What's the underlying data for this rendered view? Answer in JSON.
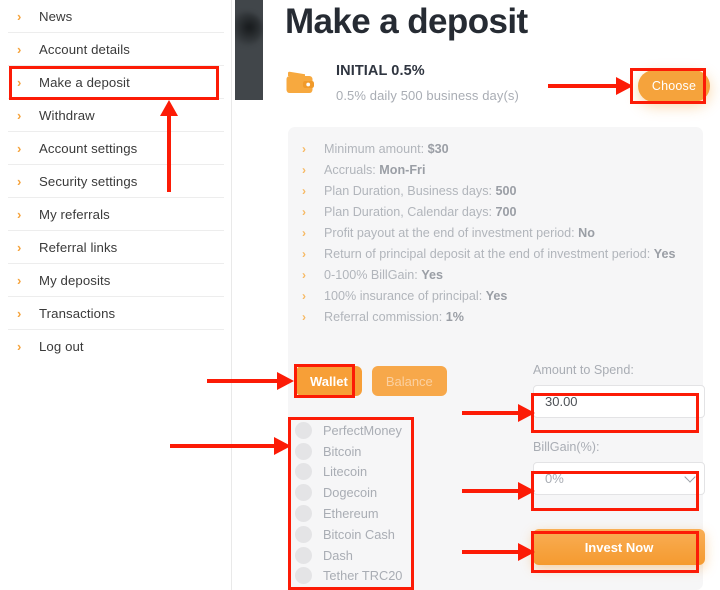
{
  "sidebar": {
    "items": [
      {
        "label": "News",
        "icon": "chevron-right-icon"
      },
      {
        "label": "Account details",
        "icon": "chevron-right-icon"
      },
      {
        "label": "Make a deposit",
        "icon": "chevron-right-icon"
      },
      {
        "label": "Withdraw",
        "icon": "chevron-right-icon"
      },
      {
        "label": "Account settings",
        "icon": "chevron-right-icon"
      },
      {
        "label": "Security settings",
        "icon": "chevron-right-icon"
      },
      {
        "label": "My referrals",
        "icon": "chevron-right-icon"
      },
      {
        "label": "Referral links",
        "icon": "chevron-right-icon"
      },
      {
        "label": "My deposits",
        "icon": "chevron-right-icon"
      },
      {
        "label": "Transactions",
        "icon": "chevron-right-icon"
      },
      {
        "label": "Log out",
        "icon": "chevron-right-icon"
      }
    ]
  },
  "main": {
    "page_title": "Make a deposit",
    "plan": {
      "icon": "wallet-icon",
      "name": "INITIAL 0.5%",
      "subtitle": "0.5% daily 500 business day(s)",
      "choose_label": "Choose"
    },
    "details": [
      {
        "label": "Minimum amount: ",
        "value": "$30"
      },
      {
        "label": "Accruals: ",
        "value": "Mon-Fri"
      },
      {
        "label": "Plan Duration, Business days: ",
        "value": "500"
      },
      {
        "label": "Plan Duration, Calendar days: ",
        "value": "700"
      },
      {
        "label": "Profit payout at the end of investment period: ",
        "value": "No"
      },
      {
        "label": "Return of principal deposit at the end of investment period: ",
        "value": "Yes"
      },
      {
        "label": "0-100% BillGain: ",
        "value": "Yes"
      },
      {
        "label": "100% insurance of principal: ",
        "value": "Yes"
      },
      {
        "label": "Referral commission: ",
        "value": "1%"
      }
    ],
    "tabs": [
      {
        "label": "Wallet",
        "active": true
      },
      {
        "label": "Balance",
        "active": false
      }
    ],
    "payment_methods": [
      {
        "label": "PerfectMoney",
        "selected": false
      },
      {
        "label": "Bitcoin",
        "selected": false
      },
      {
        "label": "Litecoin",
        "selected": false
      },
      {
        "label": "Dogecoin",
        "selected": false
      },
      {
        "label": "Ethereum",
        "selected": false
      },
      {
        "label": "Bitcoin Cash",
        "selected": false
      },
      {
        "label": "Dash",
        "selected": false
      },
      {
        "label": "Tether TRC20",
        "selected": false
      }
    ],
    "form": {
      "amount_label": "Amount to Spend:",
      "amount_value": "30.00",
      "billgain_label": "BillGain(%):",
      "billgain_value": "0%",
      "billgain_caret_icon": "chevron-down-icon",
      "invest_label": "Invest Now"
    }
  },
  "colors": {
    "accent_orange": "#f5a33c",
    "annotation_red": "#fc1b06",
    "panel_gray": "#f6f6f7",
    "title_dark": "#262b33",
    "muted_text": "#a9adb4"
  }
}
